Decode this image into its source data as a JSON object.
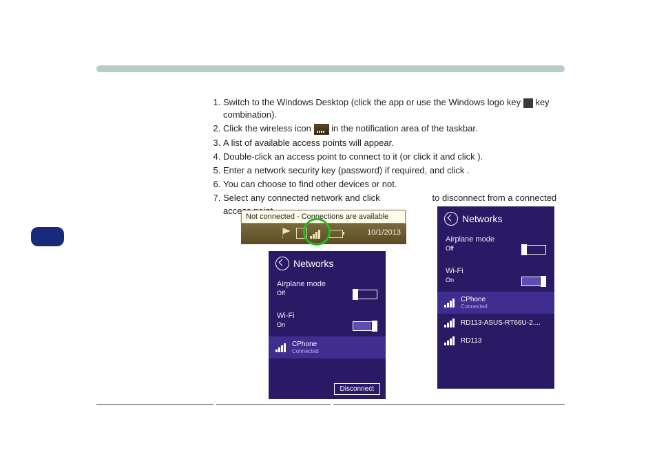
{
  "steps": {
    "s1a": "Switch to the Windows Desktop (click the app or use the Windows logo key ",
    "s1b": " key combination).",
    "s2a": "Click the wireless icon ",
    "s2b": " in the notification area of the taskbar.",
    "s3": "A list of available access points will appear.",
    "s4": "Double-click an access point to connect to it (or click it and click             ).",
    "s5": "Enter a network security key (password) if required, and click        .",
    "s6": "You can choose to find other devices or not.",
    "s7a": "Select any connected network and click ",
    "s7b": "to disconnect from a connected access point."
  },
  "tooltip": {
    "text": "Not connected - Connections are available",
    "date": "10/1/2013"
  },
  "panelA": {
    "title": "Networks",
    "airplane_label": "Airplane mode",
    "airplane_state": "Off",
    "wifi_label": "Wi-Fi",
    "wifi_state": "On",
    "net1_name": "CPhone",
    "net1_sub": "Connected",
    "disconnect": "Disconnect"
  },
  "panelB": {
    "title": "Networks",
    "airplane_label": "Airplane mode",
    "airplane_state": "Off",
    "wifi_label": "Wi-Fi",
    "wifi_state": "On",
    "net1_name": "CPhone",
    "net1_sub": "Connected",
    "net2_name": "RD113-ASUS-RT66U-2....",
    "net3_name": "RD113"
  }
}
